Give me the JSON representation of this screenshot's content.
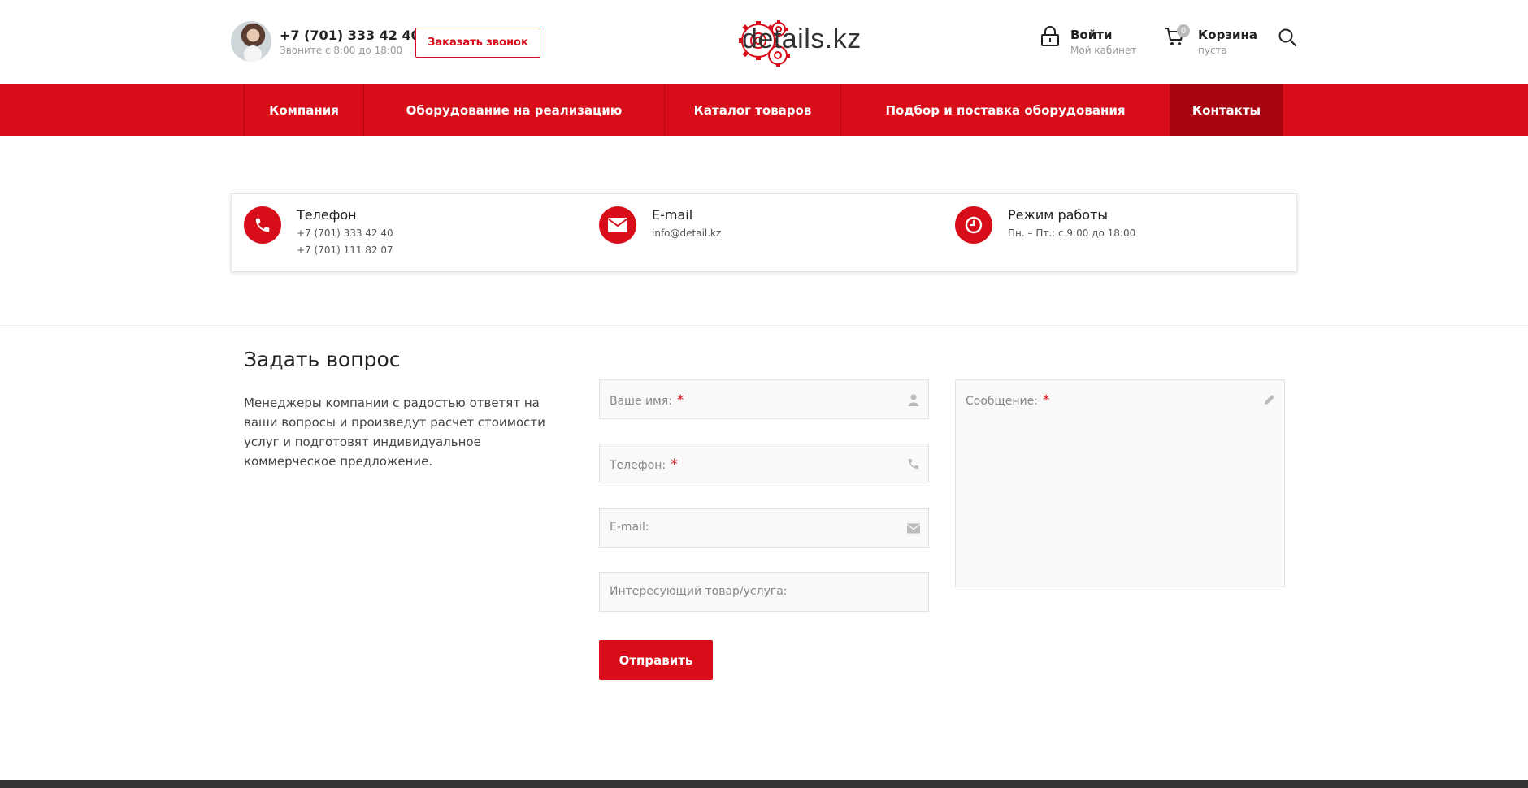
{
  "header": {
    "phone": "+7 (701) 333 42 40",
    "phone_hours": "Звоните с 8:00 до 18:00",
    "callback_label": "Заказать звонок",
    "logo_text": "details.kz",
    "login_title": "Войти",
    "login_sub": "Мой кабинет",
    "cart_title": "Корзина",
    "cart_sub": "пуста",
    "cart_count": "0"
  },
  "nav": {
    "items": [
      {
        "label": "Компания"
      },
      {
        "label": "Оборудование на реализацию"
      },
      {
        "label": "Каталог товаров"
      },
      {
        "label": "Подбор и поставка оборудования"
      },
      {
        "label": "Контакты",
        "active": true
      }
    ]
  },
  "contacts": {
    "phone_title": "Телефон",
    "phone_1": "+7 (701) 333 42 40",
    "phone_2": "+7 (701) 111 82 07",
    "email_title": "E-mail",
    "email_value": "info@detail.kz",
    "hours_title": "Режим работы",
    "hours_value": "Пн. – Пт.: с 9:00 до 18:00"
  },
  "form": {
    "title": "Задать вопрос",
    "description": "Менеджеры компании с радостью ответят на ваши вопросы и произведут расчет стоимости услуг и подготовят индивидуальное коммерческое предложение.",
    "name_label": "Ваше имя:",
    "phone_label": "Телефон:",
    "email_label": "E-mail:",
    "product_label": "Интересующий товар/услуга:",
    "message_label": "Сообщение:",
    "required_mark": "*",
    "submit_label": "Отправить"
  },
  "colors": {
    "accent": "#d70d1a",
    "accent_dark": "#a80410"
  }
}
